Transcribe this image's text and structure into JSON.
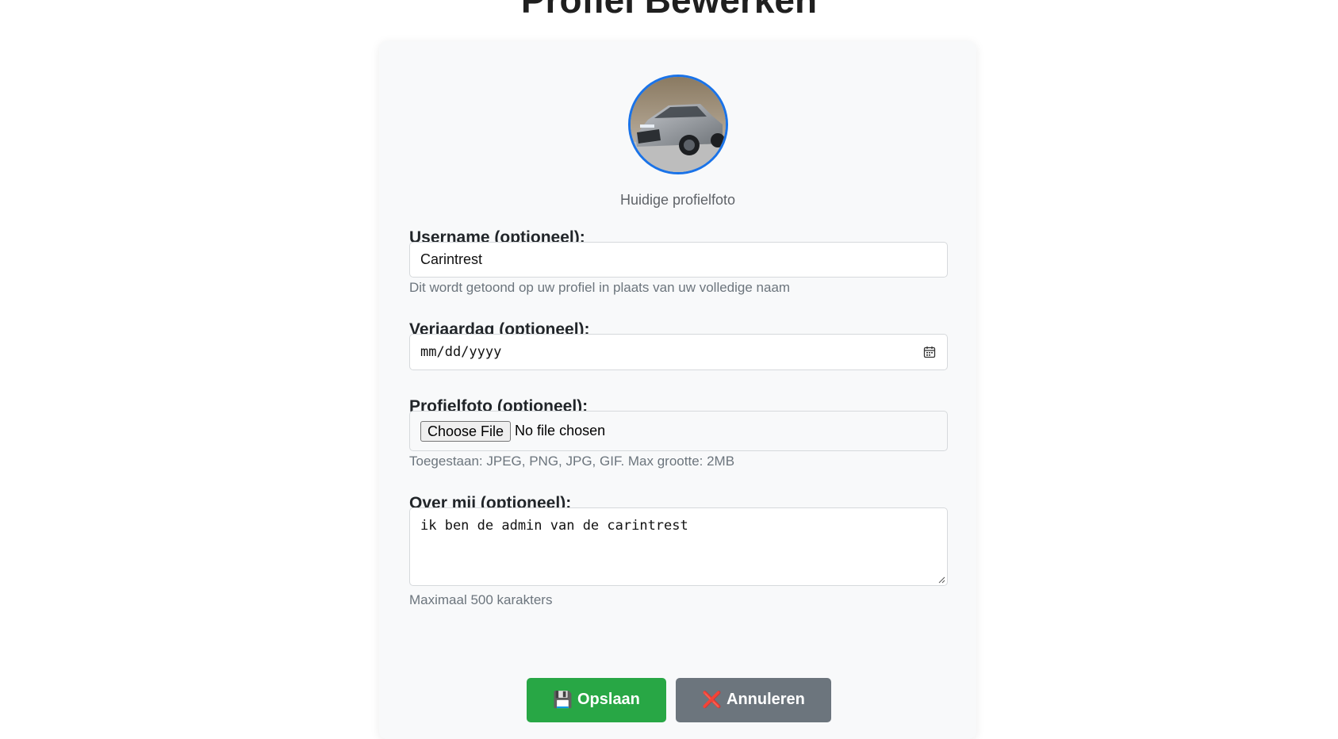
{
  "header": {
    "title": "Profiel Bewerken"
  },
  "avatar": {
    "caption": "Huidige profielfoto",
    "border_color": "#1a73e8"
  },
  "form": {
    "username": {
      "label": "Username (optioneel):",
      "value": "Carintrest",
      "help": "Dit wordt getoond op uw profiel in plaats van uw volledige naam"
    },
    "birthday": {
      "label": "Verjaardag (optioneel):",
      "placeholder": "mm/dd/yyyy",
      "icon": "calendar-icon"
    },
    "photo": {
      "label": "Profielfoto (optioneel):",
      "button_label": "Choose File",
      "status": "No file chosen",
      "help": "Toegestaan: JPEG, PNG, JPG, GIF. Max grootte: 2MB"
    },
    "about": {
      "label": "Over mij (optioneel):",
      "value": "ik ben de admin van de carintrest",
      "help": "Maximaal 500 karakters"
    }
  },
  "actions": {
    "save": {
      "icon": "💾",
      "label": "Opslaan",
      "color": "#28a745"
    },
    "cancel": {
      "icon": "❌",
      "label": "Annuleren",
      "color": "#6c757d"
    }
  }
}
